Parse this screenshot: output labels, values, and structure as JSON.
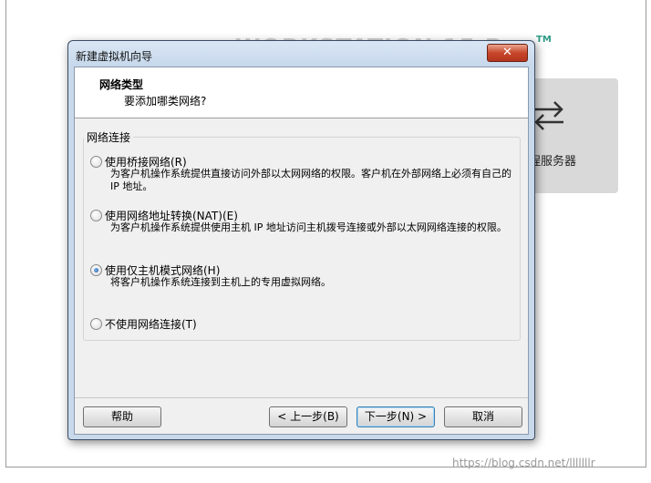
{
  "background": {
    "banner_text": "WORKSTATION 15 P",
    "banner_tm": "TM",
    "card_label": "程服务器",
    "card_icon": "swap-arrows-icon"
  },
  "dialog": {
    "title": "新建虚拟机向导",
    "close_label": "✕",
    "header": {
      "title": "网络类型",
      "subtitle": "要添加哪类网络?"
    },
    "group_label": "网络连接",
    "options": [
      {
        "label": "使用桥接网络(R)",
        "description": "为客户机操作系统提供直接访问外部以太网网络的权限。客户机在外部网络上必须有自己的 IP 地址。",
        "selected": false
      },
      {
        "label": "使用网络地址转换(NAT)(E)",
        "description": "为客户机操作系统提供使用主机 IP 地址访问主机拨号连接或外部以太网网络连接的权限。",
        "selected": false
      },
      {
        "label": "使用仅主机模式网络(H)",
        "description": "将客户机操作系统连接到主机上的专用虚拟网络。",
        "selected": true
      },
      {
        "label": "不使用网络连接(T)",
        "description": "",
        "selected": false
      }
    ],
    "buttons": {
      "help": "帮助",
      "back": "< 上一步(B)",
      "next": "下一步(N) >",
      "cancel": "取消"
    }
  },
  "watermark": "https://blog.csdn.net/lllllllr"
}
